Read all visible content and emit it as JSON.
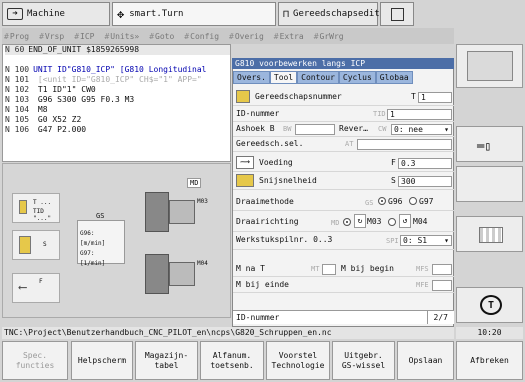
{
  "tabs": {
    "machine": "Machine",
    "turn": "smart.Turn",
    "tool_editor": "Gereedschapseditor"
  },
  "menu": [
    "Prog",
    "Vrsp",
    "ICP",
    "Units»",
    "Goto",
    "Config",
    "Overig",
    "Extra",
    "GrWrg"
  ],
  "code_lines": [
    {
      "num": "N  60",
      "text": "END_OF_UNIT $1859265998",
      "cls": "sel"
    },
    {
      "num": "",
      "text": "",
      "cls": ""
    },
    {
      "num": "N 100",
      "text": "UNIT ID\"G810_ICP\" [G810 Longitudinal",
      "cls": "blue"
    },
    {
      "num": "N 101",
      "text": "  [<unit ID=\"G810_ICP\" CH$=\"1\" APP=\"",
      "cls": "grey"
    },
    {
      "num": "N 102",
      "text": "  T1 ID\"1\" CW0",
      "cls": ""
    },
    {
      "num": "N 103",
      "text": "  G96 S300 G95 F0.3 M3",
      "cls": ""
    },
    {
      "num": "N 104",
      "text": "  M8",
      "cls": ""
    },
    {
      "num": "N 105",
      "text": "  G0 X52 Z2",
      "cls": ""
    },
    {
      "num": "N 106",
      "text": "  G47 P2.000",
      "cls": ""
    }
  ],
  "gfx": {
    "t_btn": "T ...",
    "t_btn_sub": "TID \"...\"",
    "s_btn": "S",
    "f_btn": "F",
    "gs_label": "GS",
    "g96": "G96: [m/min]",
    "g97": "G97: [1/min]",
    "md_label": "MD",
    "m03": "M03",
    "m04": "M04"
  },
  "dialog": {
    "title": "G810 voorbewerken langs ICP",
    "tabs": [
      "Overs.",
      "Tool",
      "Contour",
      "Cyclus",
      "Globaa"
    ],
    "tool_number_label": "Gereedschapsnummer",
    "t_label": "T",
    "t_value": "1",
    "id_label": "ID-nummer",
    "tid_label": "TID",
    "tid_value": "1",
    "angle_label": "Ashoek B",
    "bw_label": "BW",
    "rever_label": "Rever…",
    "cw_label": "CW",
    "cw_value": "0: nee",
    "toolsel_label": "Gereedsch.sel.",
    "at_label": "AT",
    "feed_label": "Voeding",
    "f_label": "F",
    "f_value": "0.3",
    "speed_label": "Snijsnelheid",
    "s_label": "S",
    "s_value": "300",
    "method_label": "Draaimethode",
    "gs_label": "GS",
    "g96": "G96",
    "g97": "G97",
    "dir_label": "Draairichting",
    "md_label": "MD",
    "m03": "M03",
    "m04": "M04",
    "spindle_label": "Werkstukspilnr. 0..3",
    "spi_label": "SPI",
    "spi_value": "0: S1",
    "mnat_label": "M na T",
    "mt_label": "MT",
    "mbegin_label": "M bij begin",
    "mfs_label": "MFS",
    "mend_label": "M bij einde",
    "mfe_label": "MFE",
    "footer_label": "ID-nummer",
    "footer_page": "2/7"
  },
  "status_path": "TNC:\\Project\\Benutzerhandbuch_CNC_PILOT_en\\ncps\\G820_Schruppen_en.nc",
  "clock": "10:20",
  "softkeys": [
    {
      "label": "Spec.\nfuncties",
      "disabled": true
    },
    {
      "label": "Helpscherm",
      "disabled": false
    },
    {
      "label": "Magazijn-\ntabel",
      "disabled": false
    },
    {
      "label": "Alfanum.\ntoetsenb.",
      "disabled": false
    },
    {
      "label": "Voorstel\nTechnologie",
      "disabled": false
    },
    {
      "label": "Uitgebr.\nGS-wissel",
      "disabled": false
    },
    {
      "label": "Opslaan",
      "disabled": false
    },
    {
      "label": "Afbreken",
      "disabled": false
    }
  ]
}
